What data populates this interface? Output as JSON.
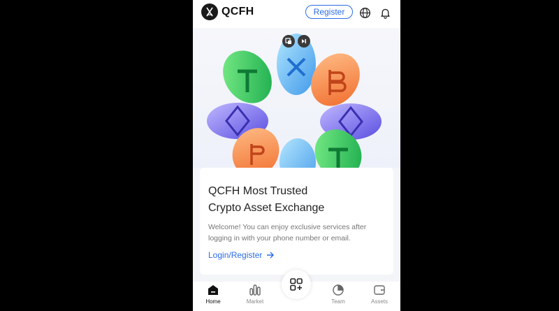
{
  "header": {
    "brand": "QCFH",
    "logo_text": "QCFH",
    "register_label": "Register",
    "icons": [
      "globe-icon",
      "bell-icon"
    ]
  },
  "hero": {
    "image": "crypto-coins-ring-illustration",
    "media_controls": [
      "picture-in-picture-icon",
      "skip-icon"
    ]
  },
  "card": {
    "title_line1": "QCFH Most Trusted",
    "title_line2": "Crypto Asset Exchange",
    "description": "Welcome! You can enjoy exclusive services after logging in with your phone number or email.",
    "login_label": "Login/Register"
  },
  "bottom_nav": {
    "items": [
      {
        "label": "Home",
        "icon": "home-icon",
        "active": true
      },
      {
        "label": "Market",
        "icon": "market-icon",
        "active": false
      },
      {
        "label": "",
        "icon": "apps-icon",
        "active": false
      },
      {
        "label": "Team",
        "icon": "team-icon",
        "active": false
      },
      {
        "label": "Assets",
        "icon": "wallet-icon",
        "active": false
      }
    ]
  },
  "colors": {
    "accent": "#2b6de8",
    "background": "#f4f5f9"
  }
}
